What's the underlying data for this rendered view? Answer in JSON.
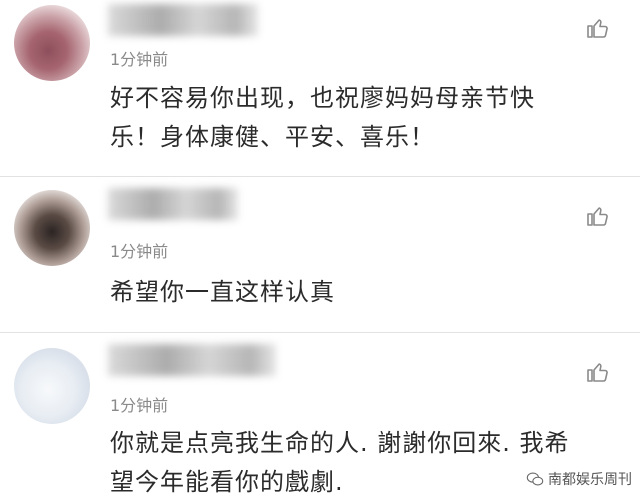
{
  "comments": [
    {
      "time": "1分钟前",
      "text_lines": [
        "好不容易你出现，也祝廖妈妈母亲节快",
        "乐！身体康健、平安、喜乐！"
      ]
    },
    {
      "time": "1分钟前",
      "text_lines": [
        "希望你一直这样认真"
      ]
    },
    {
      "time": "1分钟前",
      "text_lines": [
        "你就是点亮我生命的人. 謝謝你回來. 我希",
        "望今年能看你的戲劇."
      ]
    }
  ],
  "watermark": {
    "text": "南都娱乐周刊"
  },
  "colors": {
    "text": "#2b2b2b",
    "meta": "#8a8a8a",
    "divider": "#e2e2e2",
    "icon": "#8a8a8a"
  },
  "icons": {
    "like": "thumbs-up-icon",
    "watermark": "wechat-icon"
  }
}
